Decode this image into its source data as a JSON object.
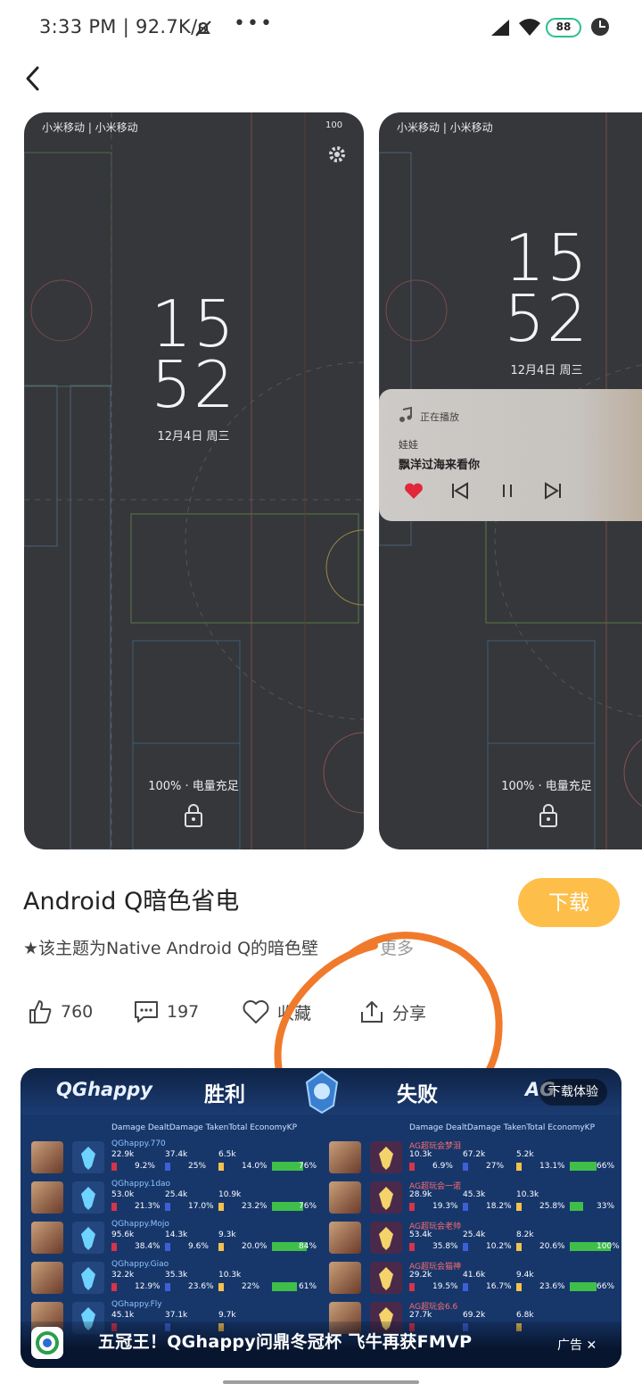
{
  "status_bar": {
    "time": "3:33 PM | 92.7K/s",
    "more": "•••",
    "battery": "88"
  },
  "preview": {
    "card1": {
      "carrier": "小米移动 | 小米移动",
      "status": "100",
      "clock_hour": "15",
      "clock_min": "52",
      "date": "12月4日 周三",
      "charge": "100% · 电量充足"
    },
    "card2": {
      "carrier": "小米移动 | 小米移动",
      "clock_hour": "15",
      "clock_min": "52",
      "date": "12月4日 周三",
      "charge": "100% · 电量充足",
      "music": {
        "playing": "正在播放",
        "artist": "娃娃",
        "song": "飘洋过海来看你"
      }
    }
  },
  "theme": {
    "title": "Android Q暗色省电",
    "download_label": "下载",
    "description": "★该主题为Native Android Q的暗色壁",
    "more_label": "更多"
  },
  "actions": {
    "like_count": "760",
    "comment_count": "197",
    "favorite_label": "收藏",
    "share_label": "分享"
  },
  "ad": {
    "team_left": "QGhappy",
    "result_win": "胜利",
    "result_lose": "失败",
    "team_right": "AG",
    "download_trial": "下载体验",
    "columns_left": "Damage DealtDamage TakenTotal EconomyKP",
    "columns_right": "Damage DealtDamage TakenTotal EconomyKP",
    "left_players": [
      {
        "name": "QGhappy.770",
        "v1": "22.9k",
        "p1": "9.2%",
        "v2": "37.4k",
        "p2": "25%",
        "v3": "6.5k",
        "p3": "14.0%",
        "kp": "76%"
      },
      {
        "name": "QGhappy.1dao",
        "v1": "53.0k",
        "p1": "21.3%",
        "v2": "25.4k",
        "p2": "17.0%",
        "v3": "10.9k",
        "p3": "23.2%",
        "kp": "76%"
      },
      {
        "name": "QGhappy.Mojo",
        "v1": "95.6k",
        "p1": "38.4%",
        "v2": "14.3k",
        "p2": "9.6%",
        "v3": "9.3k",
        "p3": "20.0%",
        "kp": "84%"
      },
      {
        "name": "QGhappy.Giao",
        "v1": "32.2k",
        "p1": "12.9%",
        "v2": "35.3k",
        "p2": "23.6%",
        "v3": "10.3k",
        "p3": "22%",
        "kp": "61%"
      },
      {
        "name": "QGhappy.Fly",
        "v1": "45.1k",
        "p1": "",
        "v2": "37.1k",
        "p2": "",
        "v3": "9.7k",
        "p3": "",
        "kp": ""
      }
    ],
    "right_players": [
      {
        "name": "AG超玩会梦泪",
        "v1": "10.3k",
        "p1": "6.9%",
        "v2": "67.2k",
        "p2": "27%",
        "v3": "5.2k",
        "p3": "13.1%",
        "kp": "66%"
      },
      {
        "name": "AG超玩会一诺",
        "v1": "28.9k",
        "p1": "19.3%",
        "v2": "45.3k",
        "p2": "18.2%",
        "v3": "10.3k",
        "p3": "25.8%",
        "kp": "33%"
      },
      {
        "name": "AG超玩会老帅",
        "v1": "53.4k",
        "p1": "35.8%",
        "v2": "25.4k",
        "p2": "10.2%",
        "v3": "8.2k",
        "p3": "20.6%",
        "kp": "100%"
      },
      {
        "name": "AG超玩会猫神",
        "v1": "29.2k",
        "p1": "19.5%",
        "v2": "41.6k",
        "p2": "16.7%",
        "v3": "9.4k",
        "p3": "23.6%",
        "kp": "66%"
      },
      {
        "name": "AG超玩会6.6",
        "v1": "27.7k",
        "p1": "",
        "v2": "69.2k",
        "p2": "",
        "v3": "6.8k",
        "p3": "",
        "kp": ""
      }
    ],
    "headline": "五冠王！QGhappy问鼎冬冠杯 飞牛再获FMVP",
    "ad_label": "广告 ✕"
  }
}
